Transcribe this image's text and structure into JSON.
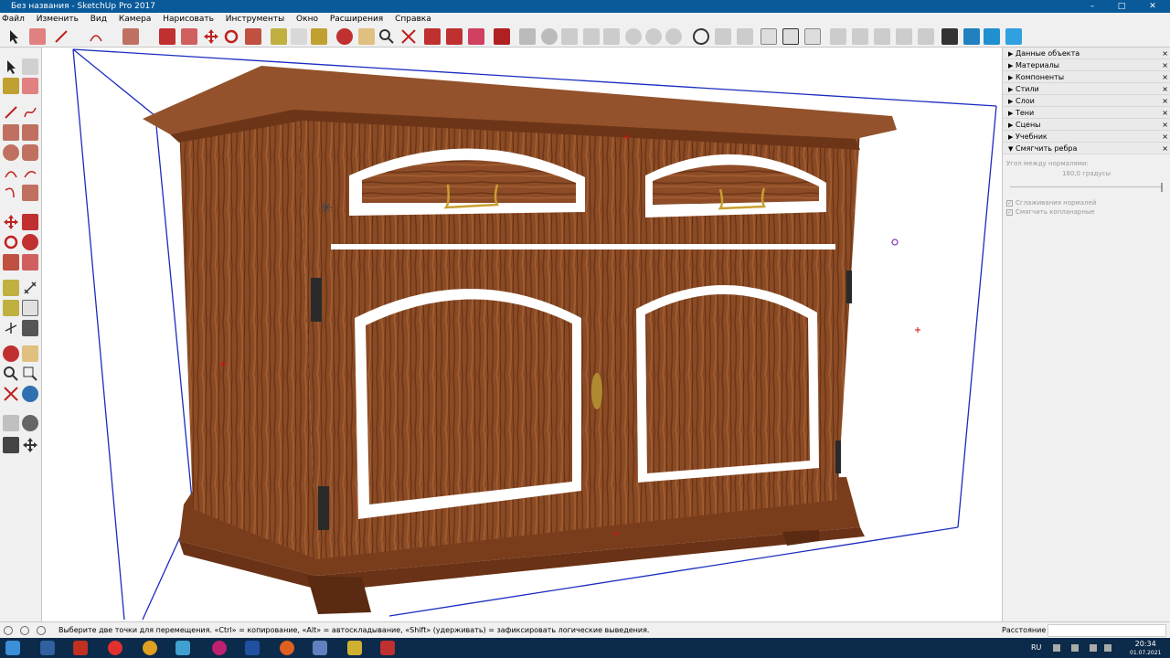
{
  "window": {
    "title": "Без названия - SketchUp Pro 2017"
  },
  "menu": [
    "Файл",
    "Изменить",
    "Вид",
    "Камера",
    "Нарисовать",
    "Инструменты",
    "Окно",
    "Расширения",
    "Справка"
  ],
  "trays": {
    "items": [
      "Данные объекта",
      "Материалы",
      "Компоненты",
      "Стили",
      "Слои",
      "Тени",
      "Сцены",
      "Учебник",
      "Смягчить ребра"
    ],
    "soften": {
      "angle_label": "Угол между нормалями:",
      "angle_value": "180,0  градусы",
      "smooth_normals": "Сглаживания нормалей",
      "soften_coplanar": "Смягчить копланарные"
    }
  },
  "status": {
    "hint": "Выберите две точки для перемещения.  «Ctrl» = копирование, «Alt» = автоскладывание, «Shift» (удерживать) = зафиксировать логические выведения.",
    "measure_label": "Расстояние"
  },
  "taskbar": {
    "lang": "RU",
    "time": "20:34",
    "date": "01.07.2021"
  },
  "colors": {
    "accent": "#0a5a9a",
    "wood": "#8b4a26",
    "selection": "#1a2cc0"
  }
}
